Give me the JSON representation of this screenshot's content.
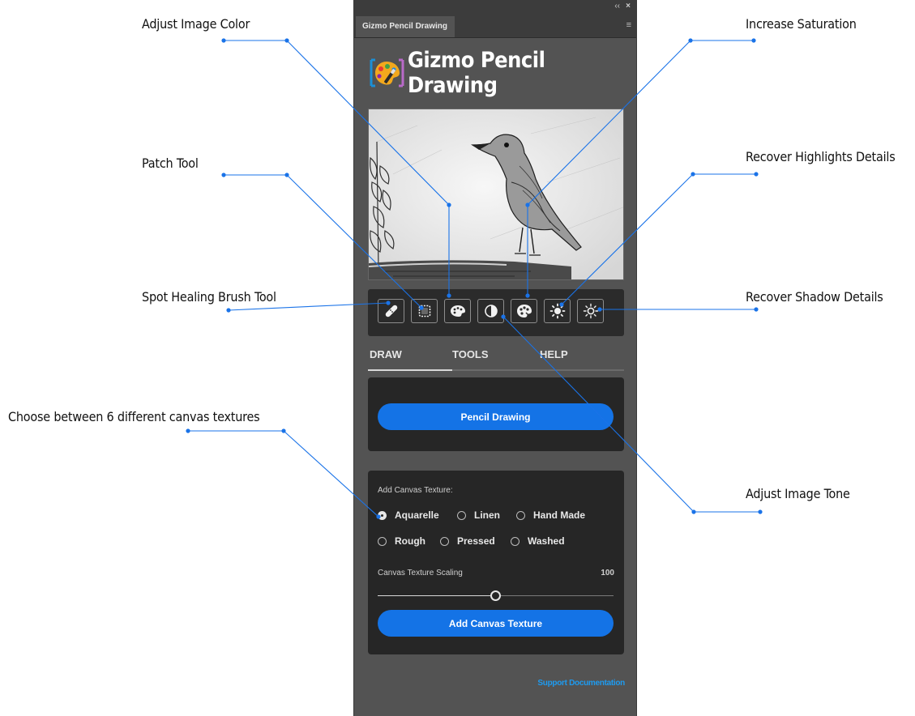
{
  "callouts": {
    "adjust_color": "Adjust Image Color",
    "patch_tool": "Patch Tool",
    "spot_healing": "Spot Healing Brush Tool",
    "canvas_textures": "Choose between 6 different canvas textures",
    "increase_saturation": "Increase Saturation",
    "recover_highlights": "Recover Highlights Details",
    "recover_shadows": "Recover Shadow Details",
    "adjust_tone": "Adjust Image Tone"
  },
  "panel": {
    "tab_label": "Gizmo Pencil Drawing",
    "collapse_glyph": "‹‹",
    "close_glyph": "×",
    "menu_glyph": "≡"
  },
  "logo": {
    "text": "Gizmo Pencil Drawing"
  },
  "toolbar": {
    "icons": [
      "bandage-icon",
      "patch-icon",
      "palette-icon",
      "contrast-icon",
      "saturation-icon",
      "highlight-sun-icon",
      "shadow-sun-icon"
    ]
  },
  "tabs": [
    "DRAW",
    "TOOLS",
    "HELP"
  ],
  "draw": {
    "button_label": "Pencil Drawing"
  },
  "texture": {
    "section_label": "Add Canvas Texture:",
    "options": [
      "Aquarelle",
      "Linen",
      "Hand Made",
      "Rough",
      "Pressed",
      "Washed"
    ],
    "selected": "Aquarelle",
    "scaling_label": "Canvas Texture Scaling",
    "scaling_value": "100",
    "slider_fraction": 0.5,
    "add_button_label": "Add Canvas Texture"
  },
  "footer": {
    "support_link": "Support Documentation"
  },
  "colors": {
    "accent": "#1473e6",
    "callout_line": "#1a73e8",
    "panel_bg": "#535353",
    "card_bg": "#262626"
  }
}
